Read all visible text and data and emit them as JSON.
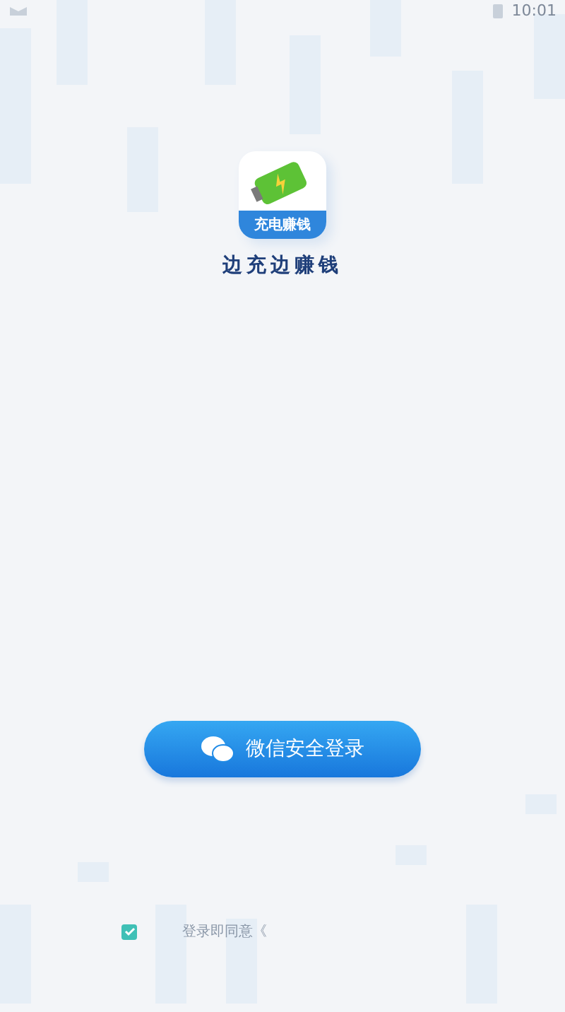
{
  "status_bar": {
    "time": "10:01"
  },
  "app": {
    "icon_label": "充电赚钱",
    "name": "边充边赚钱"
  },
  "login_button": {
    "label": "微信安全登录"
  },
  "agreement": {
    "checked": true,
    "text": "登录即同意《"
  }
}
